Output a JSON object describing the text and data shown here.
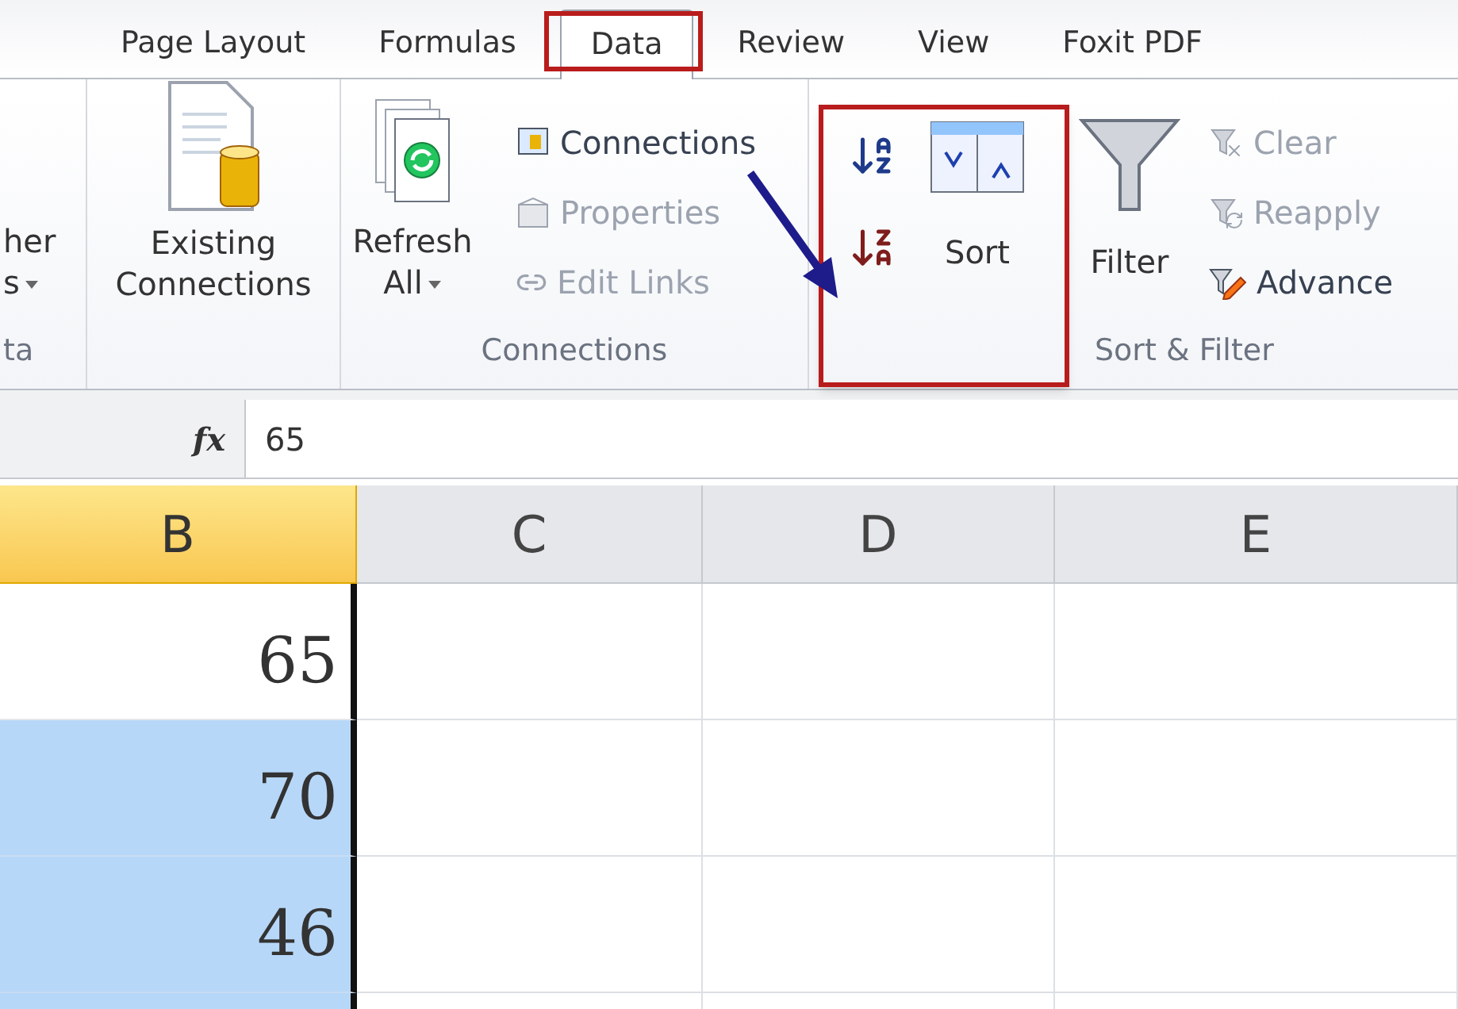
{
  "tabs": [
    {
      "label": "Page Layout",
      "selected": false
    },
    {
      "label": "Formulas",
      "selected": false
    },
    {
      "label": "Data",
      "selected": true
    },
    {
      "label": "Review",
      "selected": false
    },
    {
      "label": "View",
      "selected": false
    },
    {
      "label": "Foxit PDF",
      "selected": false
    }
  ],
  "ribbon": {
    "partial_group": {
      "label_lines": [
        "her",
        "s"
      ],
      "dropdown": true,
      "group_label": "ta"
    },
    "existing_connections": {
      "label_lines": [
        "Existing",
        "Connections"
      ]
    },
    "connections_group": {
      "label": "Connections",
      "refresh": {
        "label_lines": [
          "Refresh",
          "All"
        ],
        "dropdown": true
      },
      "items": [
        {
          "kind": "connections",
          "label": "Connections",
          "disabled": false
        },
        {
          "kind": "properties",
          "label": "Properties",
          "disabled": true
        },
        {
          "kind": "links",
          "label": "Edit Links",
          "disabled": true
        }
      ]
    },
    "sort_filter_group": {
      "label": "Sort & Filter",
      "sort_buttons": [
        {
          "kind": "asc"
        },
        {
          "kind": "desc"
        }
      ],
      "sort": {
        "label": "Sort"
      },
      "filter": {
        "label": "Filter"
      },
      "items": [
        {
          "kind": "clear",
          "label": "Clear",
          "disabled": true
        },
        {
          "kind": "reapply",
          "label": "Reapply",
          "disabled": true
        },
        {
          "kind": "advanced",
          "label": "Advance",
          "disabled": false
        }
      ]
    }
  },
  "formula_bar": {
    "function_label": "fx",
    "value": "65"
  },
  "columns": [
    {
      "label": "B",
      "selected": true
    },
    {
      "label": "C",
      "selected": false
    },
    {
      "label": "D",
      "selected": false
    },
    {
      "label": "E",
      "selected": false
    }
  ],
  "rows": [
    {
      "value": "65",
      "selected": false
    },
    {
      "value": "70",
      "selected": true
    },
    {
      "value": "46",
      "selected": true
    },
    {
      "selected": true
    }
  ]
}
